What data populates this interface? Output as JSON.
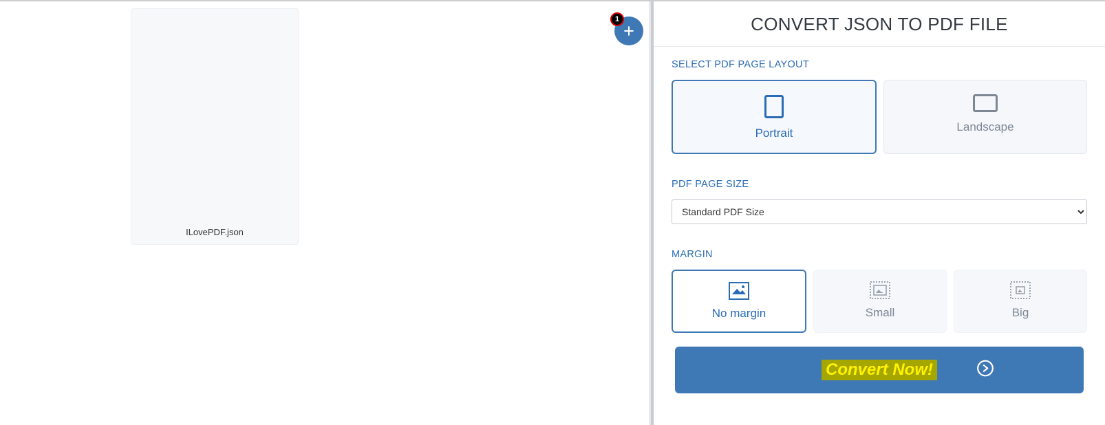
{
  "file": {
    "name": "ILovePDF.json"
  },
  "add_button": {
    "badge": "1"
  },
  "panel": {
    "title": "CONVERT JSON TO PDF FILE",
    "layout_label": "SELECT PDF PAGE LAYOUT",
    "layout_options": {
      "portrait": "Portrait",
      "landscape": "Landscape"
    },
    "size_label": "PDF PAGE SIZE",
    "size_selected": "Standard PDF Size",
    "margin_label": "MARGIN",
    "margin_options": {
      "none": "No margin",
      "small": "Small",
      "big": "Big"
    },
    "convert_label": "Convert Now!"
  }
}
